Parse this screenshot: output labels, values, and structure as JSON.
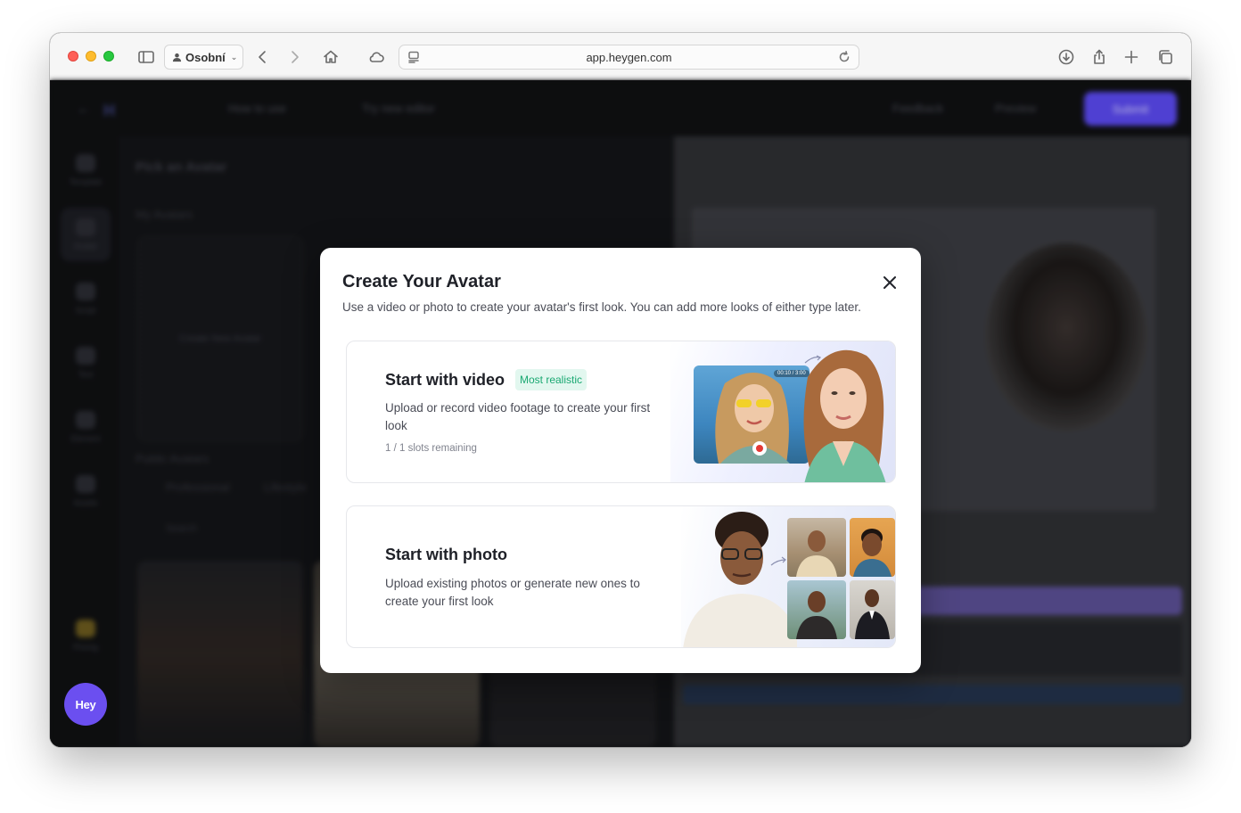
{
  "browser": {
    "profile_label": "Osobní",
    "url": "app.heygen.com"
  },
  "app": {
    "topbar": {
      "back_label": "",
      "howto_label": "How to use",
      "try_label": "Try new editor",
      "feedback_label": "Feedback",
      "preview_label": "Preview",
      "submit_label": "Submit"
    },
    "rail": [
      {
        "label": "Template"
      },
      {
        "label": "Avatar"
      },
      {
        "label": "Script"
      },
      {
        "label": "Text"
      },
      {
        "label": "Element"
      },
      {
        "label": "Assets"
      },
      {
        "label": "Pricing"
      }
    ],
    "panel": {
      "title": "Pick an Avatar",
      "my_avatars": "My Avatars",
      "create_new": "Create New Avatar",
      "public_avatars": "Public Avatars",
      "filter_tabs": [
        "Professional",
        "Lifestyle"
      ],
      "search_placeholder": "Search"
    },
    "hey_button": "Hey"
  },
  "modal": {
    "title": "Create Your Avatar",
    "description": "Use a video or photo to create your avatar's first look. You can add more looks of either type later.",
    "options": [
      {
        "title": "Start with video",
        "badge": "Most realistic",
        "description": "Upload or record video footage to create your first look",
        "slots": "1 / 1 slots remaining",
        "timer": "00:10 / 3:00"
      },
      {
        "title": "Start with photo",
        "description": "Upload existing photos or generate new ones to create your first look"
      }
    ]
  },
  "colors": {
    "accent": "#5a49f0",
    "badge_text": "#1aa872",
    "badge_bg": "#e2f7ef",
    "hey_button": "#6b4ff0"
  }
}
